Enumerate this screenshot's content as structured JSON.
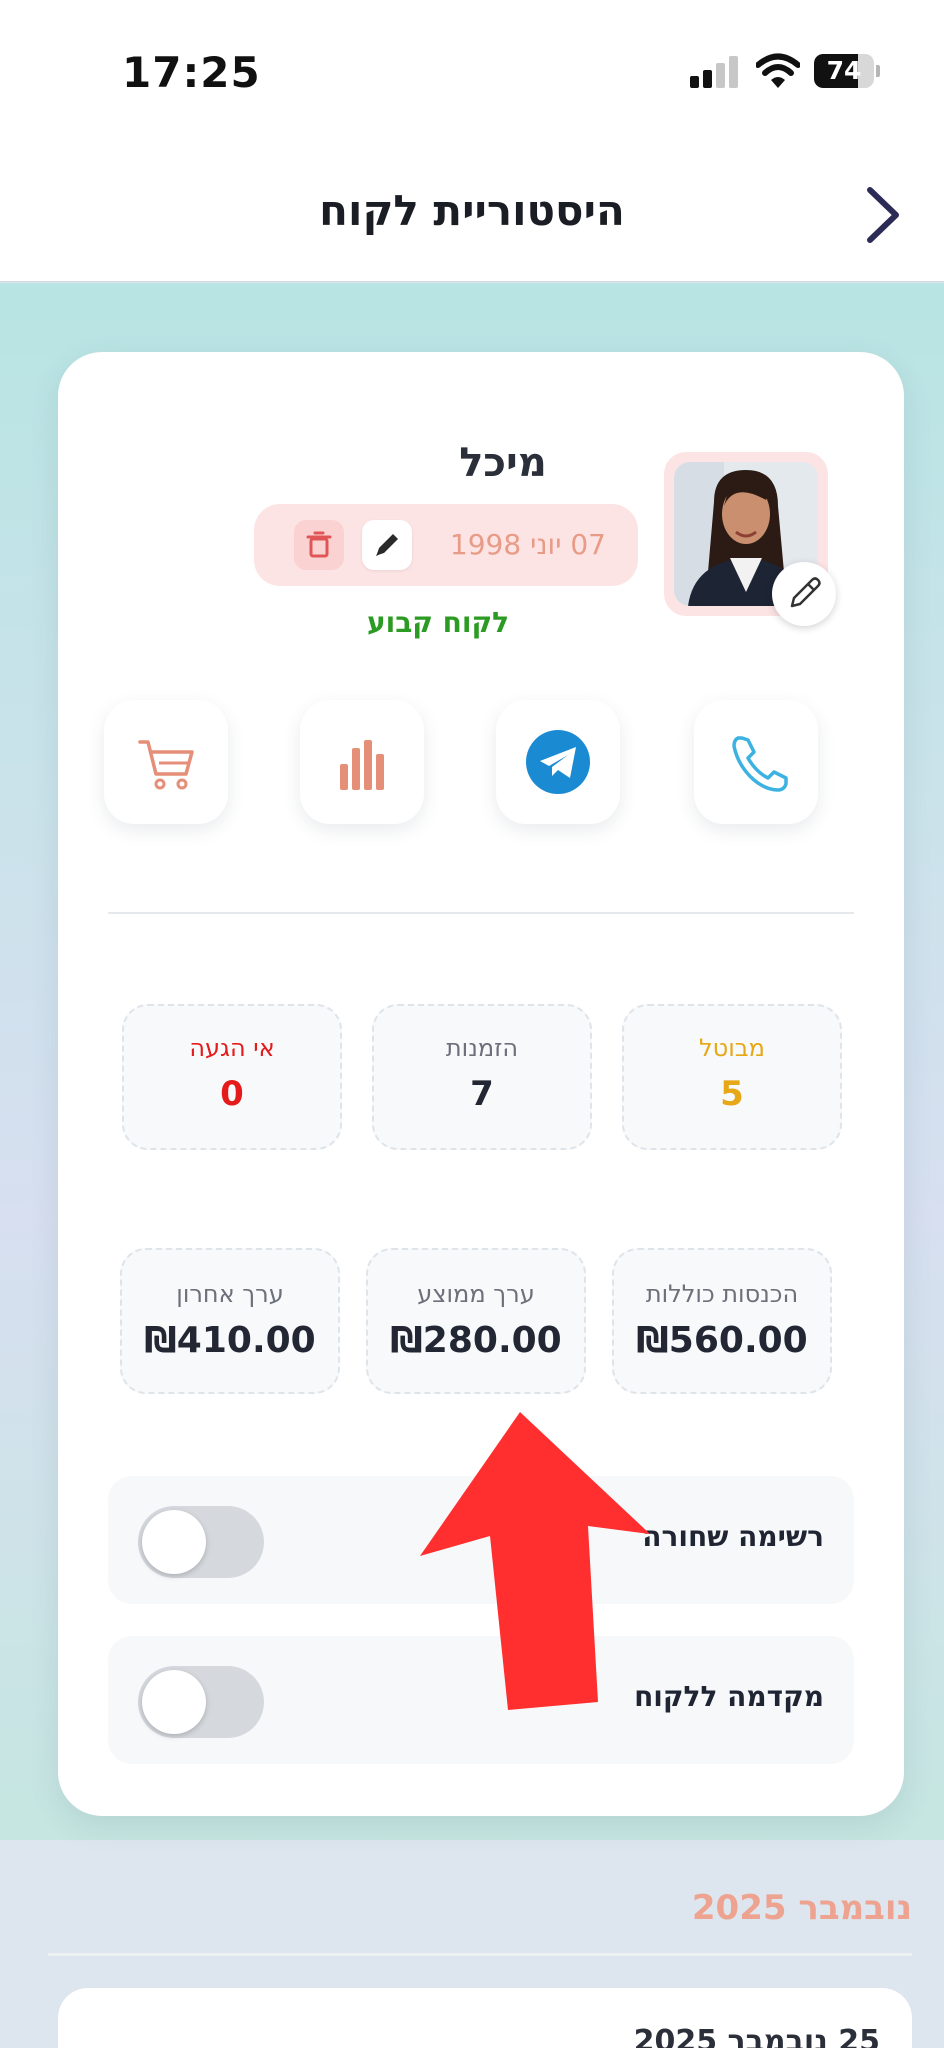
{
  "status_bar": {
    "time": "17:25",
    "battery": "74",
    "battery_level": 0.74
  },
  "header": {
    "title": "היסטוריית לקוח"
  },
  "profile": {
    "name": "מיכל",
    "birthday": "07 יוני 1998",
    "status": "לקוח קבוע"
  },
  "actions": [
    {
      "name": "call",
      "icon": "phone-icon"
    },
    {
      "name": "telegram",
      "icon": "telegram-icon"
    },
    {
      "name": "stats",
      "icon": "bar-chart-icon"
    },
    {
      "name": "cart",
      "icon": "cart-icon"
    }
  ],
  "stats": {
    "cancelled": {
      "label": "מבוטל",
      "value": "5",
      "color": "#e6a817"
    },
    "orders": {
      "label": "הזמנות",
      "value": "7",
      "color": "#232733"
    },
    "no_show": {
      "label": "אי הגעה",
      "value": "0",
      "color": "#e51b1b"
    }
  },
  "money": {
    "total_income": {
      "label": "הכנסות כוללות",
      "value": "₪560.00"
    },
    "average_value": {
      "label": "ערך ממוצע",
      "value": "₪280.00"
    },
    "last_value": {
      "label": "ערך אחרון",
      "value": "₪410.00"
    }
  },
  "toggles": {
    "blacklist": {
      "label": "רשימה שחורה",
      "on": false
    },
    "prepayment": {
      "label": "מקדמה ללקוח",
      "on": false
    }
  },
  "history": {
    "month": "נובמבר 2025",
    "first_entry_date": "25 נובמבר 2025"
  },
  "colors": {
    "accent": "#e89b87",
    "telegram": "#1a8ad3",
    "phone": "#3bb2e2",
    "arrow": "#ff2f2f"
  }
}
